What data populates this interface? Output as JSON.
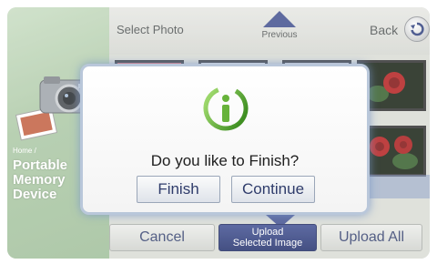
{
  "colors": {
    "accent": "#3b4a8a",
    "dialog_text": "#202020",
    "info_green": "#67b33a",
    "button_text": "#2f3c6b"
  },
  "left_panel": {
    "home_path": "Home /",
    "title_lines": [
      "Portable",
      "Memory",
      "Device"
    ]
  },
  "header": {
    "title": "Select Photo",
    "previous_label": "Previous",
    "back_label": "Back"
  },
  "bottom_bar": {
    "cancel_label": "Cancel",
    "upload_selected_line1": "Upload",
    "upload_selected_line2": "Selected Image",
    "upload_all_label": "Upload All"
  },
  "dialog": {
    "icon": "info-icon",
    "message": "Do you like to Finish?",
    "finish_label": "Finish",
    "continue_label": "Continue"
  }
}
